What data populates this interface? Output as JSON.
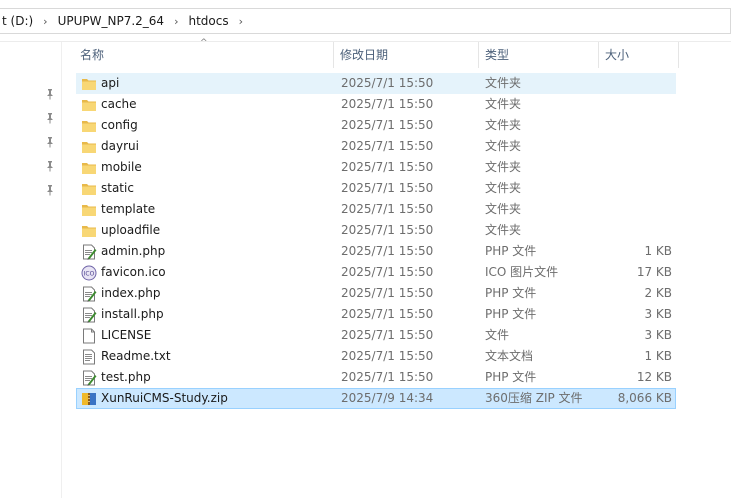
{
  "breadcrumb": {
    "items": [
      "t (D:)",
      "UPUPW_NP7.2_64",
      "htdocs"
    ],
    "separator": "›"
  },
  "columns": {
    "name": "名称",
    "date": "修改日期",
    "type": "类型",
    "size": "大小"
  },
  "files": [
    {
      "name": "api",
      "date": "2025/7/1 15:50",
      "type": "文件夹",
      "size": "",
      "icon": "folder-icon",
      "state": "hover"
    },
    {
      "name": "cache",
      "date": "2025/7/1 15:50",
      "type": "文件夹",
      "size": "",
      "icon": "folder-icon",
      "state": ""
    },
    {
      "name": "config",
      "date": "2025/7/1 15:50",
      "type": "文件夹",
      "size": "",
      "icon": "folder-icon",
      "state": ""
    },
    {
      "name": "dayrui",
      "date": "2025/7/1 15:50",
      "type": "文件夹",
      "size": "",
      "icon": "folder-icon",
      "state": ""
    },
    {
      "name": "mobile",
      "date": "2025/7/1 15:50",
      "type": "文件夹",
      "size": "",
      "icon": "folder-icon",
      "state": ""
    },
    {
      "name": "static",
      "date": "2025/7/1 15:50",
      "type": "文件夹",
      "size": "",
      "icon": "folder-icon",
      "state": ""
    },
    {
      "name": "template",
      "date": "2025/7/1 15:50",
      "type": "文件夹",
      "size": "",
      "icon": "folder-icon",
      "state": ""
    },
    {
      "name": "uploadfile",
      "date": "2025/7/1 15:50",
      "type": "文件夹",
      "size": "",
      "icon": "folder-icon",
      "state": ""
    },
    {
      "name": "admin.php",
      "date": "2025/7/1 15:50",
      "type": "PHP 文件",
      "size": "1 KB",
      "icon": "php-file-icon",
      "state": ""
    },
    {
      "name": "favicon.ico",
      "date": "2025/7/1 15:50",
      "type": "ICO 图片文件",
      "size": "17 KB",
      "icon": "ico-file-icon",
      "state": ""
    },
    {
      "name": "index.php",
      "date": "2025/7/1 15:50",
      "type": "PHP 文件",
      "size": "2 KB",
      "icon": "php-file-icon",
      "state": ""
    },
    {
      "name": "install.php",
      "date": "2025/7/1 15:50",
      "type": "PHP 文件",
      "size": "3 KB",
      "icon": "php-file-icon",
      "state": ""
    },
    {
      "name": "LICENSE",
      "date": "2025/7/1 15:50",
      "type": "文件",
      "size": "3 KB",
      "icon": "blank-file-icon",
      "state": ""
    },
    {
      "name": "Readme.txt",
      "date": "2025/7/1 15:50",
      "type": "文本文档",
      "size": "1 KB",
      "icon": "text-file-icon",
      "state": ""
    },
    {
      "name": "test.php",
      "date": "2025/7/1 15:50",
      "type": "PHP 文件",
      "size": "12 KB",
      "icon": "php-file-icon",
      "state": ""
    },
    {
      "name": "XunRuiCMS-Study.zip",
      "date": "2025/7/9 14:34",
      "type": "360压缩 ZIP 文件",
      "size": "8,066 KB",
      "icon": "zip-archive-icon",
      "state": "sel"
    }
  ],
  "colors": {
    "folder": "#f8d775",
    "selection": "#cce8ff",
    "hover": "#e5f3fb",
    "header_text": "#4c607a"
  }
}
